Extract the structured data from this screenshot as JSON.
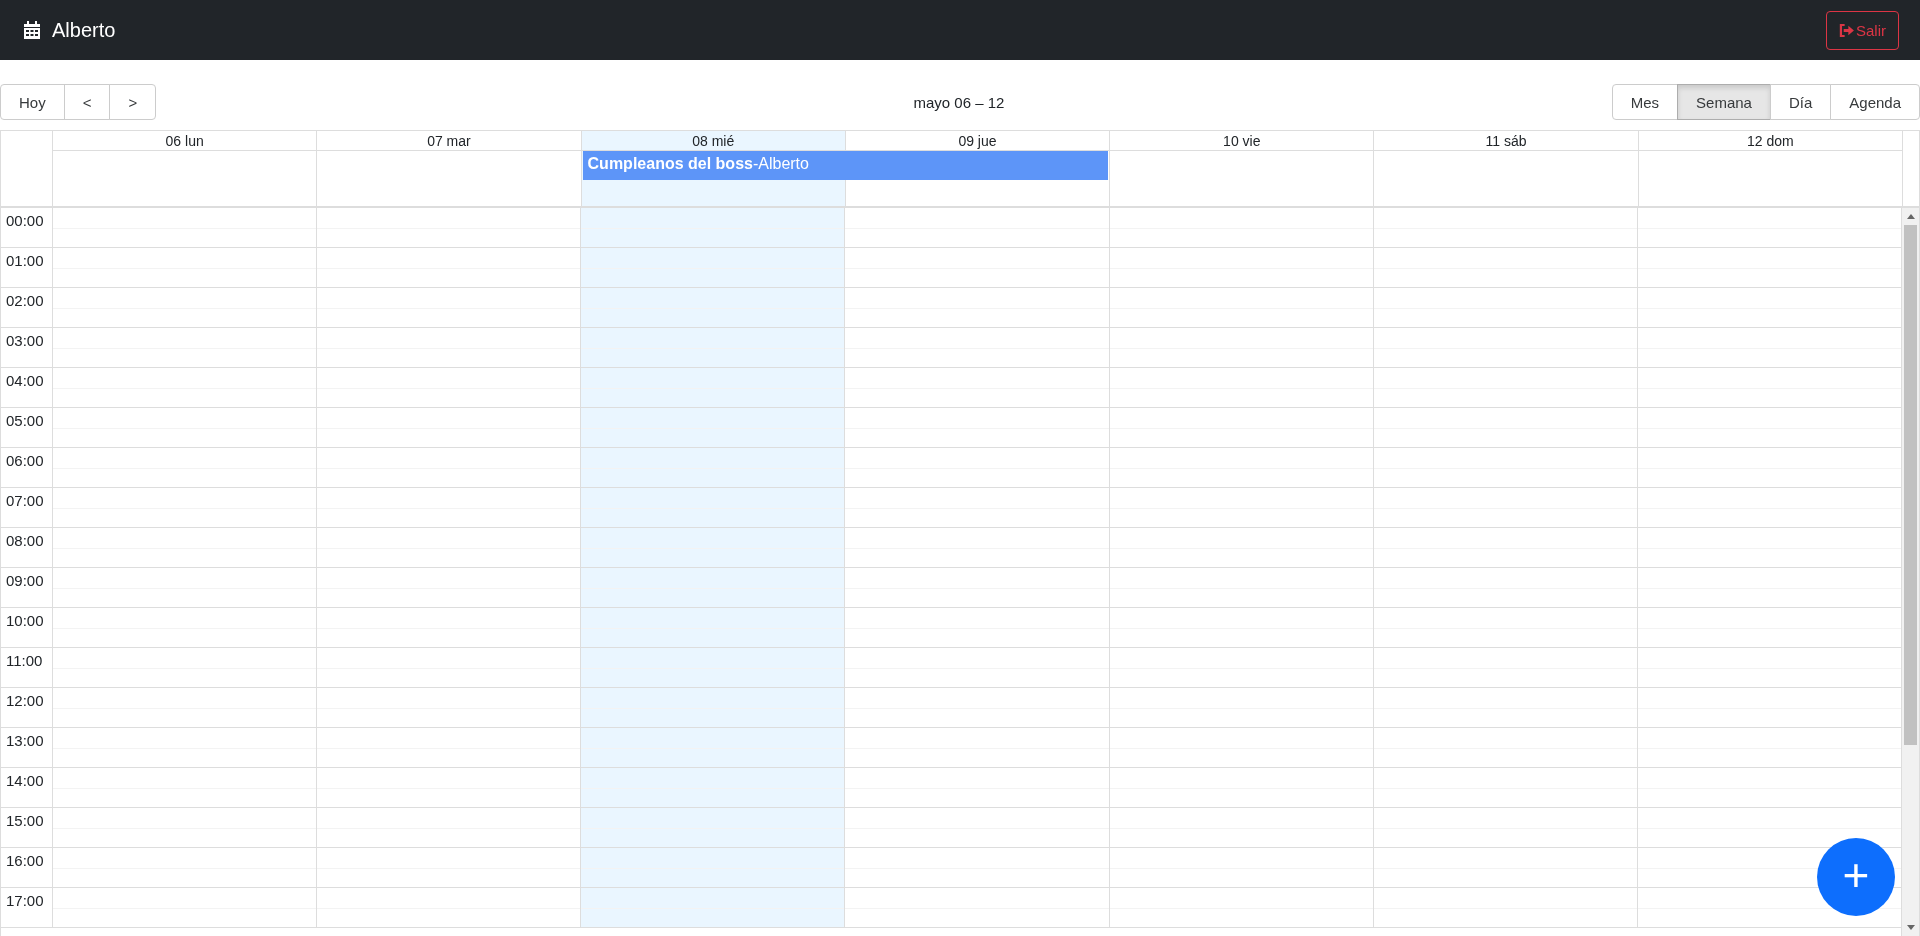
{
  "navbar": {
    "title": "Alberto",
    "logout_button": "Salir"
  },
  "toolbar": {
    "nav_buttons": [
      "Hoy",
      "<",
      ">"
    ],
    "range_label": "mayo 06 – 12",
    "views": [
      {
        "label": "Mes",
        "selected": false
      },
      {
        "label": "Semana",
        "selected": true
      },
      {
        "label": "Día",
        "selected": false
      },
      {
        "label": "Agenda",
        "selected": false
      }
    ]
  },
  "days": [
    {
      "label": "06 lun",
      "today": false
    },
    {
      "label": "07 mar",
      "today": false
    },
    {
      "label": "08 mié",
      "today": true,
      "events": [
        {
          "title": "Cumpleanos del boss",
          "organizer": "-Alberto",
          "continues_next_day": true
        }
      ]
    },
    {
      "label": "09 jue",
      "today": false
    },
    {
      "label": "10 vie",
      "today": false
    },
    {
      "label": "11 sáb",
      "today": false
    },
    {
      "label": "12 dom",
      "today": false
    }
  ],
  "hours": [
    "00:00",
    "01:00",
    "02:00",
    "03:00",
    "04:00",
    "05:00",
    "06:00",
    "07:00",
    "08:00",
    "09:00",
    "10:00",
    "11:00",
    "12:00",
    "13:00",
    "14:00",
    "15:00",
    "16:00",
    "17:00"
  ],
  "add_button": {
    "label": "+"
  }
}
